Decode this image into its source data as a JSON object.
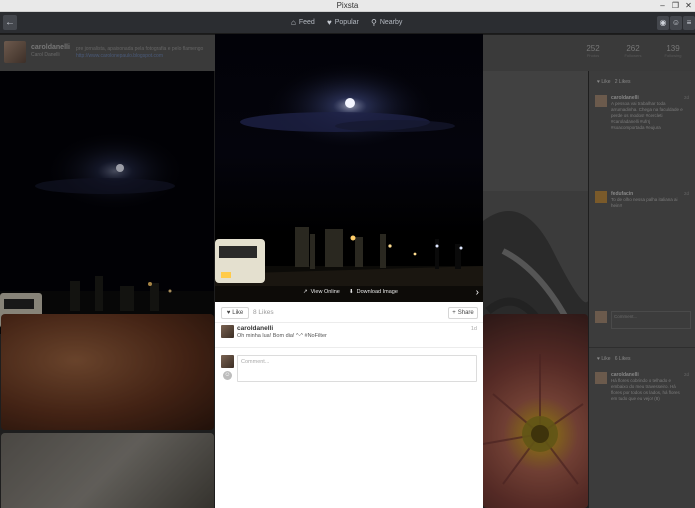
{
  "window": {
    "title": "Pixsta"
  },
  "nav": {
    "back_icon": "arrow-left-icon",
    "items": [
      {
        "label": "Feed",
        "icon": "home-icon"
      },
      {
        "label": "Popular",
        "icon": "heart-icon"
      },
      {
        "label": "Nearby",
        "icon": "location-pin-icon"
      }
    ]
  },
  "profile": {
    "username": "caroldanelli",
    "fullname": "Carol Danelli",
    "bio": "pre jornalista, apaixonada pela fotografia e pelo flamengo",
    "link": "http://www.carolonepaulo.blogspot.com",
    "stats": [
      {
        "value": "252",
        "label": "Photos"
      },
      {
        "value": "262",
        "label": "Followers"
      },
      {
        "value": "139",
        "label": "Following"
      }
    ]
  },
  "post": {
    "actions": {
      "view_online": "View Online",
      "download_image": "Download Image"
    },
    "like_label": "Like",
    "likes_count": "8 Likes",
    "share_label": "Share",
    "caption": {
      "username": "caroldanelli",
      "text": "Oh minha lua! Bom dia! ^-^ #NoFilter",
      "time": "1d"
    },
    "comment_placeholder": "Comment..."
  },
  "side_cards": [
    {
      "like_label": "Like",
      "likes": "2 Likes",
      "comments": [
        {
          "user": "caroldanelli",
          "text": "A pessoa vai trabalhar toda arrumadinha. Chega na faculdade e perde os modos! #cercleti #caroladanelli #ufrrj #soacomportada #eujura",
          "time": "2d"
        },
        {
          "user": "fedufacin",
          "text": "To de olho nessa palha italiana ai hein!!",
          "time": "2d"
        }
      ],
      "comment_placeholder": "Comment..."
    },
    {
      "like_label": "Like",
      "likes": "6 Likes",
      "comments": [
        {
          "user": "caroldanelli",
          "text": "Há flores cobrindo o telhado e embaixo do meu travesseiro. Há flores por todos os lados, há flores em tudo que eu vejo! (8)",
          "time": "2d"
        }
      ]
    }
  ]
}
